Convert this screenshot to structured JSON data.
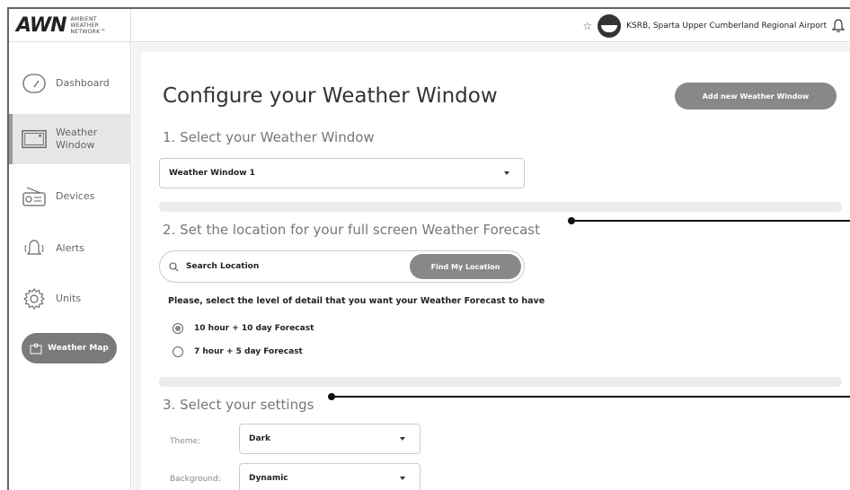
{
  "header": {
    "logo_mark": "AWN",
    "logo_sub_1": "AMBIENT",
    "logo_sub_2": "WEATHER",
    "logo_sub_3": "NETWORK™",
    "station_name": "KSRB, Sparta Upper Cumberland Regional Airport"
  },
  "sidebar": {
    "items": [
      {
        "label": "Dashboard",
        "icon": "gauge-icon"
      },
      {
        "label_1": "Weather",
        "label_2": "Window",
        "icon": "monitor-icon",
        "active": true
      },
      {
        "label": "Devices",
        "icon": "radio-device-icon"
      },
      {
        "label": "Alerts",
        "icon": "bell-icon"
      },
      {
        "label": "Units",
        "icon": "gear-icon"
      }
    ],
    "map_button": "Weather Map"
  },
  "main": {
    "title": "Configure your Weather Window",
    "add_button": "Add new Weather Window",
    "section1": {
      "title": "1. Select your Weather Window",
      "selected": "Weather Window 1"
    },
    "section2": {
      "title": "2. Set the location for your full screen Weather Forecast",
      "search_placeholder": "Search Location",
      "find_button": "Find My Location",
      "detail_prompt": "Please, select the level of detail that you want your Weather Forecast to have",
      "options": [
        {
          "label": "10 hour + 10 day Forecast",
          "selected": true
        },
        {
          "label": "7 hour + 5 day Forecast",
          "selected": false
        }
      ]
    },
    "section3": {
      "title": "3. Select your settings",
      "theme_label": "Theme:",
      "theme_value": "Dark",
      "background_label": "Background:",
      "background_value": "Dynamic"
    }
  },
  "colors": {
    "accent_gray": "#888888",
    "active_nav": "#e6e6e6"
  }
}
